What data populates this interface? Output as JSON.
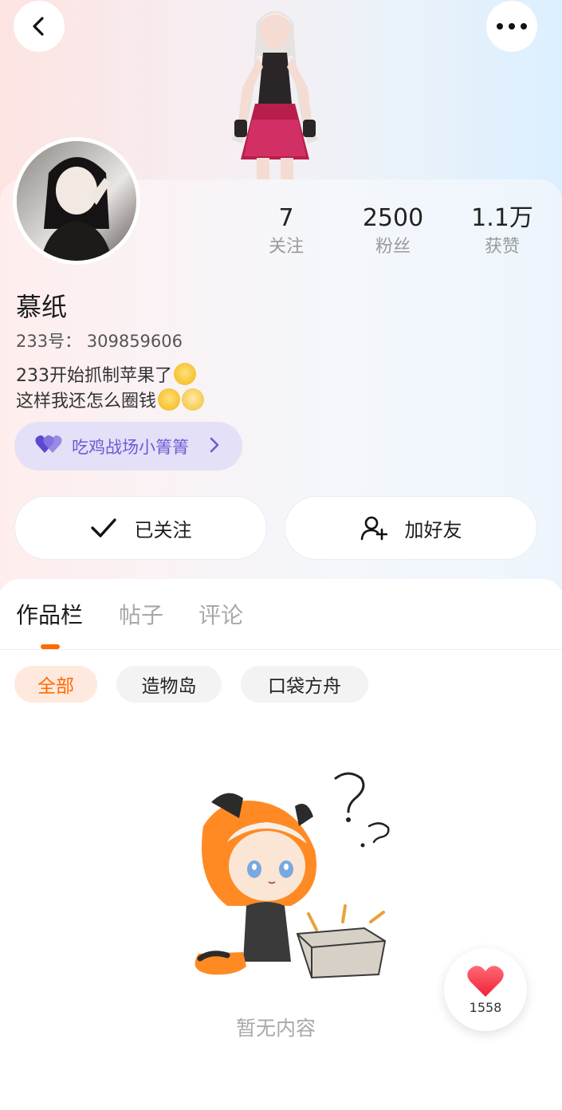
{
  "header": {
    "back_icon": "chevron-left-icon",
    "more_icon": "more-horizontal-icon"
  },
  "profile": {
    "nickname": "慕纸",
    "uid_text": "233号： 309859606",
    "bio_line1": "233开始抓制苹果了",
    "bio_line2": "这样我还怎么圈钱",
    "stats": [
      {
        "value": "7",
        "label": "关注"
      },
      {
        "value": "2500",
        "label": "粉丝"
      },
      {
        "value": "1.1万",
        "label": "获赞"
      }
    ]
  },
  "game_pill": {
    "label": "吃鸡战场小箐箐",
    "accent": "#6b5bd4"
  },
  "actions": {
    "follow_label": "已关注",
    "add_friend_label": "加好友"
  },
  "tabs": [
    {
      "label": "作品栏",
      "active": true
    },
    {
      "label": "帖子",
      "active": false
    },
    {
      "label": "评论",
      "active": false
    }
  ],
  "chips": [
    {
      "label": "全部",
      "active": true
    },
    {
      "label": "造物岛",
      "active": false
    },
    {
      "label": "口袋方舟",
      "active": false
    }
  ],
  "empty_state": {
    "text": "暂无内容"
  },
  "like_float": {
    "count": "1558"
  },
  "colors": {
    "accent": "#ff6a00",
    "pill_bg": "#e4e0f7",
    "heart": "#ff3b4a"
  }
}
